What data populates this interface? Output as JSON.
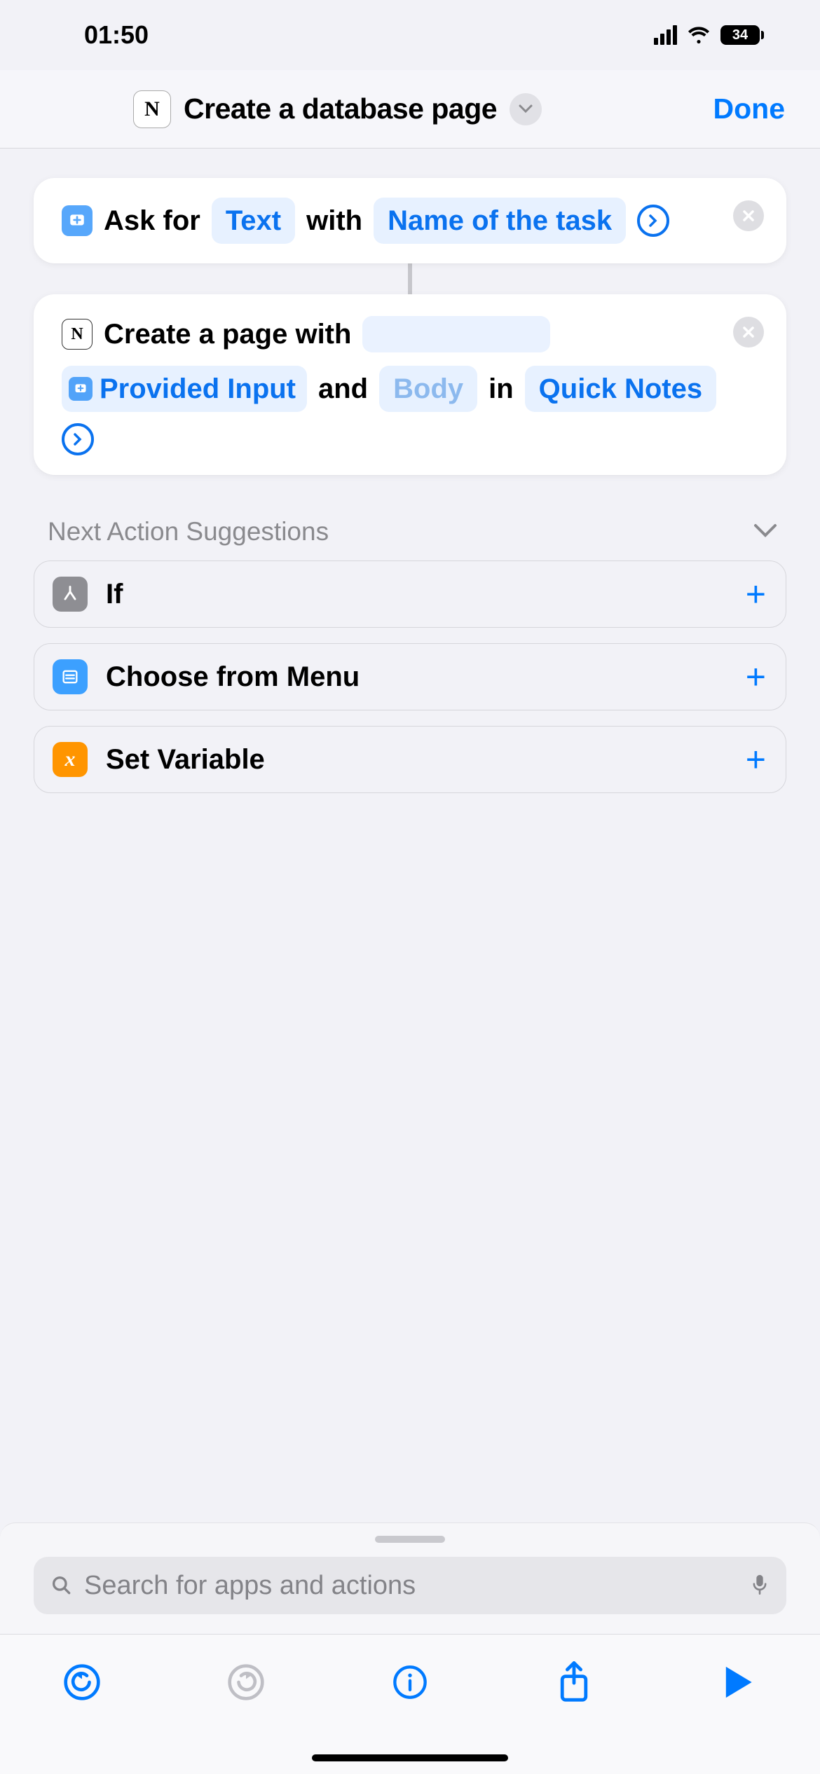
{
  "status_bar": {
    "time": "01:50",
    "battery_pct": "34"
  },
  "header": {
    "title": "Create a database page",
    "done_label": "Done"
  },
  "actions": {
    "ask": {
      "prefix": "Ask for",
      "type_token": "Text",
      "middle": "with",
      "prompt_token": "Name of the task"
    },
    "create": {
      "prefix": "Create a page with",
      "input_token": "Provided Input",
      "and": "and",
      "body_token": "Body",
      "in": "in",
      "dest_token": "Quick Notes"
    }
  },
  "suggestions": {
    "title": "Next Action Suggestions",
    "items": [
      "If",
      "Choose from Menu",
      "Set Variable"
    ]
  },
  "search": {
    "placeholder": "Search for apps and actions"
  }
}
